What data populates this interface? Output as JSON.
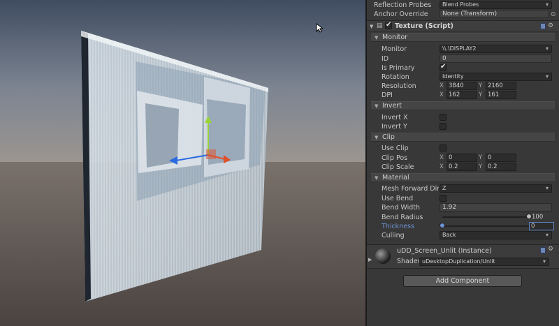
{
  "inspector": {
    "reflection_probes": {
      "label": "Reflection Probes",
      "value": "Blend Probes"
    },
    "anchor_override": {
      "label": "Anchor Override",
      "value": "None (Transform)"
    },
    "component": {
      "title": "Texture (Script)",
      "enabled": true
    },
    "monitor_section": {
      "title": "Monitor",
      "monitor": {
        "label": "Monitor",
        "value": "\\\\.\\DISPLAY2"
      },
      "id": {
        "label": "ID",
        "value": "0"
      },
      "is_primary": {
        "label": "Is Primary",
        "checked": true
      },
      "rotation": {
        "label": "Rotation",
        "value": "Identity"
      },
      "resolution": {
        "label": "Resolution",
        "x_key": "X",
        "x": "3840",
        "y_key": "Y",
        "y": "2160"
      },
      "dpi": {
        "label": "DPI",
        "x_key": "X",
        "x": "162",
        "y_key": "Y",
        "y": "161"
      }
    },
    "invert_section": {
      "title": "Invert",
      "invert_x": {
        "label": "Invert X",
        "checked": false
      },
      "invert_y": {
        "label": "Invert Y",
        "checked": false
      }
    },
    "clip_section": {
      "title": "Clip",
      "use_clip": {
        "label": "Use Clip",
        "checked": false
      },
      "clip_pos": {
        "label": "Clip Pos",
        "x_key": "X",
        "x": "0",
        "y_key": "Y",
        "y": "0"
      },
      "clip_scale": {
        "label": "Clip Scale",
        "x_key": "X",
        "x": "0.2",
        "y_key": "Y",
        "y": "0.2"
      }
    },
    "material_section": {
      "title": "Material",
      "mesh_forward": {
        "label": "Mesh Forward Dire",
        "value": "Z"
      },
      "use_bend": {
        "label": "Use Bend",
        "checked": false
      },
      "bend_width": {
        "label": "Bend Width",
        "value": "1.92"
      },
      "bend_radius": {
        "label": "Bend Radius",
        "value": "100",
        "level": 1.0
      },
      "thickness": {
        "label": "Thickness",
        "value": "0",
        "level": 0.0
      },
      "culling": {
        "label": "Culling",
        "value": "Back"
      }
    },
    "material_asset": {
      "name": "uDD_Screen_Unlit (Instance)",
      "shader_label": "Shader",
      "shader_value": "uDesktopDuplication/Unlit"
    },
    "add_component": "Add Component"
  },
  "colors": {
    "panel_bg": "#383838",
    "section_bg": "#454545",
    "highlight_label": "#6d93d4",
    "gizmo_red": "#e0502a",
    "gizmo_blue": "#2a6ae0",
    "gizmo_green": "#9ad23a",
    "sky_top": "#45546a",
    "ground": "#574f4b"
  }
}
